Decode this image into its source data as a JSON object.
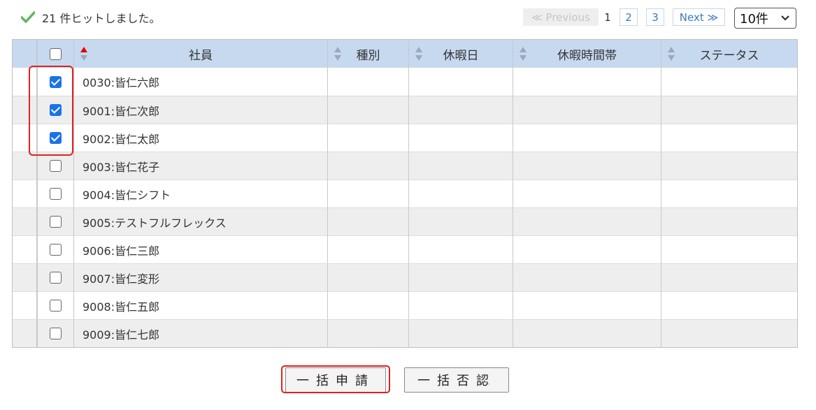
{
  "result": {
    "text": "21 件ヒットしました。",
    "icon": "check-icon"
  },
  "pager": {
    "previous": "≪ Previous",
    "current": "1",
    "pages": [
      "2",
      "3"
    ],
    "next": "Next ≫",
    "per_page": "10件"
  },
  "table": {
    "headers": {
      "employee": "社員",
      "type": "種別",
      "leave_date": "休暇日",
      "leave_time": "休暇時間帯",
      "status": "ステータス"
    },
    "rows": [
      {
        "employee": "0030:皆仁六郎",
        "checked": true
      },
      {
        "employee": "9001:皆仁次郎",
        "checked": true
      },
      {
        "employee": "9002:皆仁太郎",
        "checked": true
      },
      {
        "employee": "9003:皆仁花子",
        "checked": false
      },
      {
        "employee": "9004:皆仁シフト",
        "checked": false
      },
      {
        "employee": "9005:テストフルフレックス",
        "checked": false
      },
      {
        "employee": "9006:皆仁三郎",
        "checked": false
      },
      {
        "employee": "9007:皆仁変形",
        "checked": false
      },
      {
        "employee": "9008:皆仁五郎",
        "checked": false
      },
      {
        "employee": "9009:皆仁七郎",
        "checked": false
      }
    ]
  },
  "actions": {
    "bulk_apply": "一括申請",
    "bulk_reject": "一括否認"
  },
  "colors": {
    "accent": "#1a73e8",
    "header_bg": "#c7d9ef",
    "highlight": "#e02020"
  }
}
